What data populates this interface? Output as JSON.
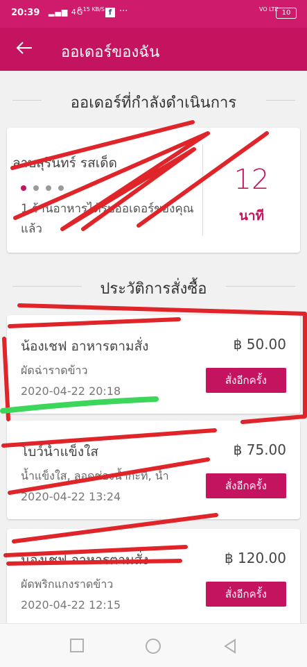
{
  "status_bar": {
    "time": "20:39",
    "network": "4G",
    "speed": "0.15 KB/S",
    "fb": "f",
    "more": "···",
    "volte": "VO LTE",
    "battery": "10"
  },
  "app_bar": {
    "back_icon": "arrow-left-icon",
    "title": "ออเดอร์ของฉัน"
  },
  "active_section": {
    "title": "ออเดอร์ที่กำลังดำเนินการ",
    "card": {
      "shop": "ลาบสุรินทร์ รสเด็ด",
      "progress_step": 1,
      "progress_total": 4,
      "message": "1 ร้านอาหารได้รับออเดอร์ของคุณแล้ว",
      "minutes": "12",
      "unit": "นาที"
    }
  },
  "history_section": {
    "title": "ประวัติการสั่งซื้อ",
    "orders": [
      {
        "shop": "น้องเชฟ อาหารตามสั่ง",
        "price": "฿ 50.00",
        "items": "ผัดฉ่าราดข้าว",
        "date": "2020-04-22 20:18",
        "reorder": "สั่งอีกครั้ง"
      },
      {
        "shop": "โบว์น้ำแข็งใส",
        "price": "฿ 75.00",
        "items": "น้ำแข็งใส, ลอดช่องน้ำกะทิ, น้ำ",
        "date": "2020-04-22 13:24",
        "reorder": "สั่งอีกครั้ง"
      },
      {
        "shop": "น้องเชฟ อาหารตามสั่ง",
        "price": "฿ 120.00",
        "items": "ผัดพริกแกงราดข้าว",
        "date": "2020-04-22 12:15",
        "reorder": "สั่งอีกครั้ง"
      }
    ]
  },
  "nav_bar": {
    "recent_icon": "square-icon",
    "home_icon": "circle-icon",
    "back_icon": "triangle-back-icon"
  },
  "colors": {
    "accent": "#c4145f",
    "status_bar": "#cf1b6b",
    "scribble": "#e0252a",
    "highlight": "#3cd65a"
  }
}
